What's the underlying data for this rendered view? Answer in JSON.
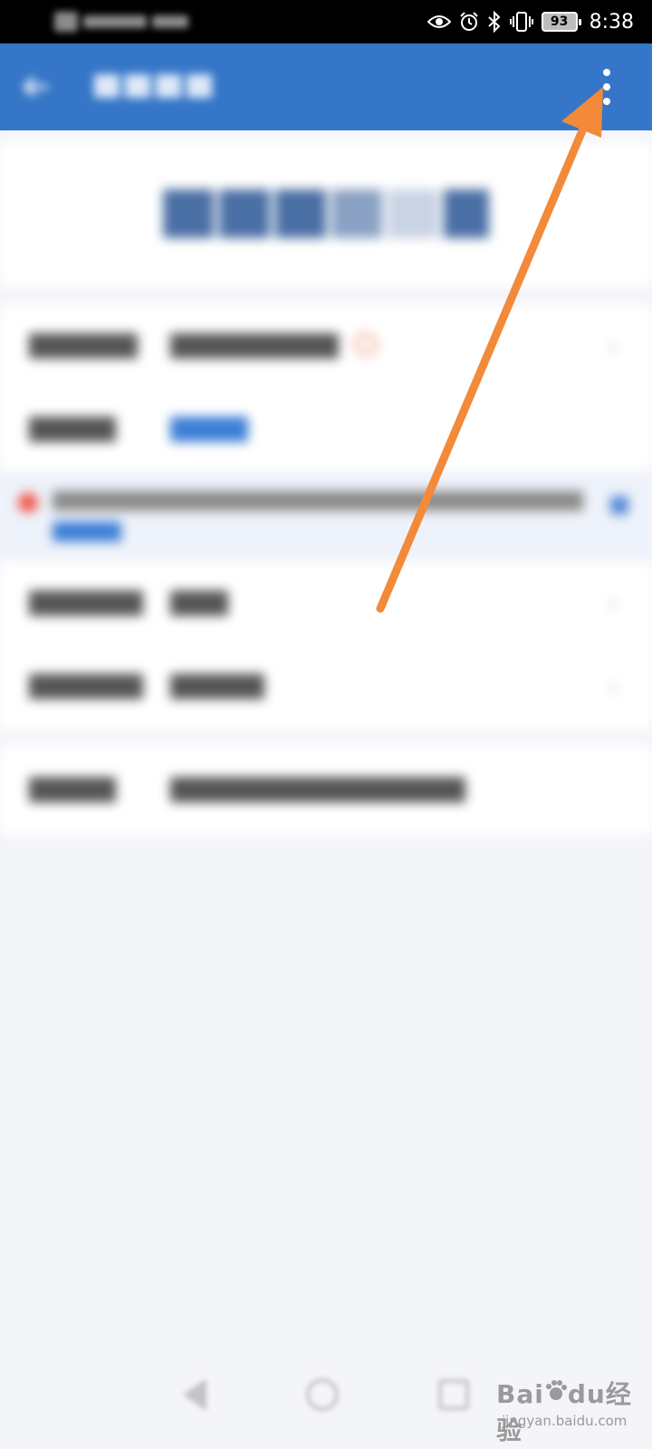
{
  "status_bar": {
    "time": "8:38",
    "battery_level": "93",
    "icons": [
      "eye-icon",
      "alarm-icon",
      "bluetooth-icon",
      "vibrate-icon",
      "battery-icon"
    ]
  },
  "app_bar": {
    "back_icon": "arrow-left-icon",
    "more_icon": "more-vertical-icon",
    "color": "#3576c8"
  },
  "annotation": {
    "arrow_color": "#f28a3a"
  },
  "nav_bar": {
    "icons": [
      "nav-back-icon",
      "nav-home-icon",
      "nav-recent-icon"
    ]
  },
  "watermark": {
    "brand": "Bai",
    "brand_suffix": "du",
    "service": "经验",
    "url": "jingyan.baidu.com"
  }
}
